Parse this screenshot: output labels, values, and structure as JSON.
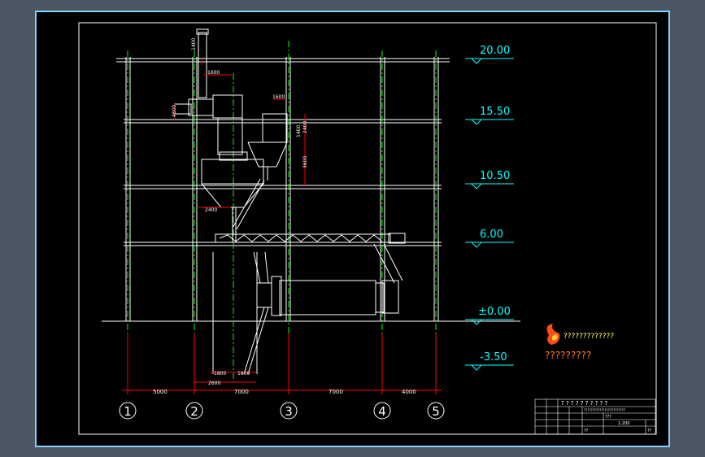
{
  "levels": [
    {
      "label": "20.00"
    },
    {
      "label": "15.50"
    },
    {
      "label": "10.50"
    },
    {
      "label": "6.00"
    },
    {
      "label": "±0.00"
    },
    {
      "label": "-3.50"
    }
  ],
  "axes": [
    {
      "label": "1"
    },
    {
      "label": "2"
    },
    {
      "label": "3"
    },
    {
      "label": "4"
    },
    {
      "label": "5"
    }
  ],
  "spans": [
    {
      "label": "5000"
    },
    {
      "label": "7000"
    },
    {
      "label": "7000"
    },
    {
      "label": "4000"
    }
  ],
  "dims": {
    "top_small": "1400",
    "top_width": "1600",
    "sep_width": "1600",
    "left_height": "4600",
    "right_height1": "2400",
    "right_height2": "1400",
    "right_height3": "3600",
    "cone_width": "2400",
    "bot_left": "1800",
    "bot_right": "1800",
    "bot_total": "2600"
  },
  "logo": {
    "text1": "?????????????",
    "text2": "?????????"
  },
  "title_block": {
    "header": "? ? ? ? ? ? ? ? ? ?",
    "row1": "????????????????????????",
    "row2": "???",
    "row3": "1:200",
    "cell_a": "??",
    "cell_b": "??"
  },
  "colors": {
    "background": "#4b5863",
    "sheet": "#000000",
    "frame": "#ffffff",
    "axis_line": "#00ff00",
    "dimension": "#ff0000",
    "cyan": "#00ffff",
    "drawing": "#ffffff"
  }
}
